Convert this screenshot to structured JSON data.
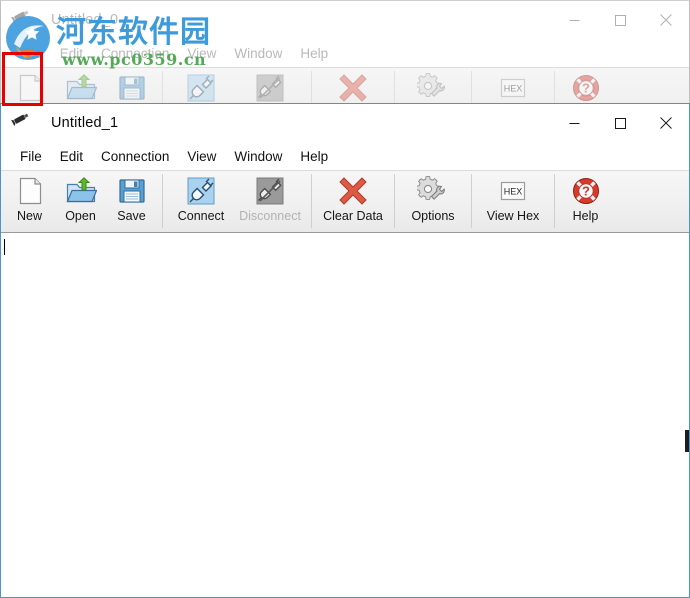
{
  "app": {
    "menu": [
      "File",
      "Edit",
      "Connection",
      "View",
      "Window",
      "Help"
    ],
    "toolbar": [
      {
        "label": "New",
        "icon": "new-document-icon",
        "enabled": true
      },
      {
        "label": "Open",
        "icon": "open-folder-icon",
        "enabled": true
      },
      {
        "label": "Save",
        "icon": "floppy-disk-icon",
        "enabled": true
      },
      {
        "label": "Connect",
        "icon": "plug-connect-icon",
        "enabled": true
      },
      {
        "label": "Disconnect",
        "icon": "plug-disconnect-icon",
        "enabled": false
      },
      {
        "label": "Clear Data",
        "icon": "red-cross-icon",
        "enabled": true
      },
      {
        "label": "Options",
        "icon": "gear-wrench-icon",
        "enabled": true
      },
      {
        "label": "View Hex",
        "icon": "hex-button-icon",
        "enabled": true
      },
      {
        "label": "Help",
        "icon": "lifebuoy-question-icon",
        "enabled": true
      }
    ],
    "hex_icon_text": "HEX",
    "window_buttons": {
      "minimize": "minimize-button",
      "maximize": "maximize-button",
      "close": "close-button"
    }
  },
  "background_window": {
    "title": "Untitled_0",
    "active": false
  },
  "active_window": {
    "title": "Untitled_1",
    "active": true,
    "editor_text": ""
  },
  "annotation": {
    "highlight_target": "New",
    "color": "#e60000"
  },
  "watermark": {
    "site_name": "河东软件园",
    "url": "www.pc0359.cn",
    "name_color": "#3d9bdc",
    "url_color": "#53a957"
  }
}
